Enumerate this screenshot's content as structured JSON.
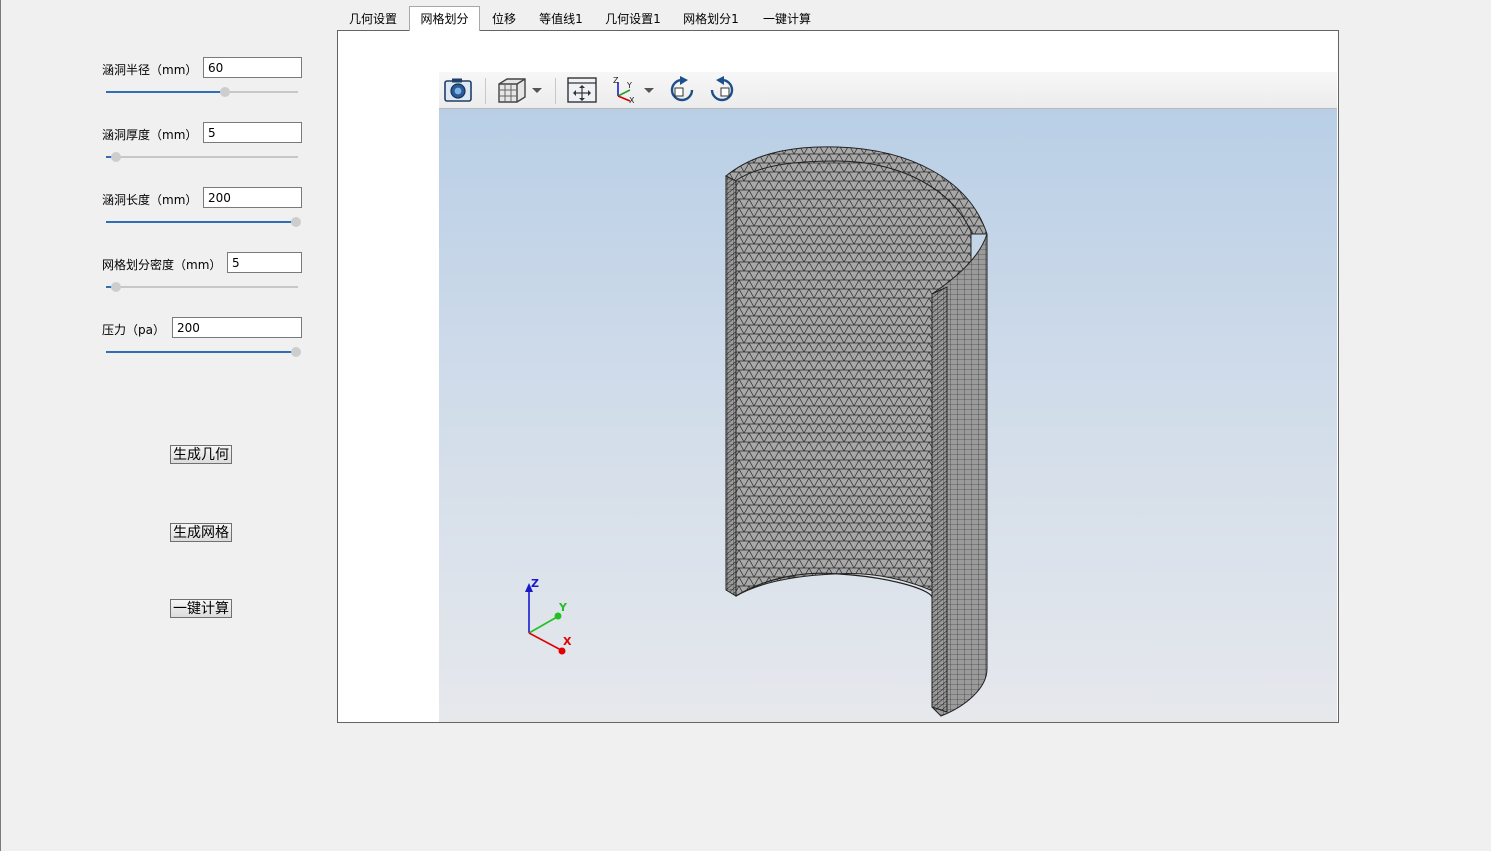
{
  "params": [
    {
      "label": "涵洞半径（mm）",
      "value": "60",
      "slider_fraction": 0.62
    },
    {
      "label": "涵洞厚度（mm）",
      "value": "5",
      "slider_fraction": 0.04
    },
    {
      "label": "涵洞长度（mm）",
      "value": "200",
      "slider_fraction": 1.0
    },
    {
      "label": "网格划分密度（mm）",
      "value": "5",
      "slider_fraction": 0.04
    },
    {
      "label": "压力（pa）",
      "value": "200",
      "slider_fraction": 1.0
    }
  ],
  "buttons": {
    "geometry": "生成几何",
    "mesh": "生成网格",
    "compute": "一键计算"
  },
  "tabs": [
    "几何设置",
    "网格划分",
    "位移",
    "等值线1",
    "几何设置1",
    "网格划分1",
    "一键计算"
  ],
  "active_tab": "网格划分",
  "toolbar": [
    "camera-icon",
    "view-cube-icon",
    "fit-view-icon",
    "axes-orientation-icon",
    "rotate-cw-icon",
    "rotate-ccw-icon"
  ],
  "axes_triad": {
    "z": "Z",
    "y": "Y",
    "x": "X"
  },
  "colors": {
    "slider_fill": "#2f6fb3",
    "mesh_surface": "#a9a9a9",
    "mesh_lines": "#2a2a2a",
    "axis_x": "#e00000",
    "axis_y": "#22c022",
    "axis_z": "#1a1acc"
  }
}
